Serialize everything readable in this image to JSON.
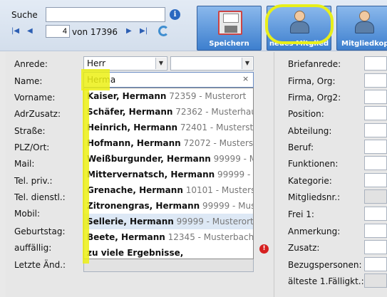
{
  "toolbar": {
    "search_label": "Suche",
    "search_value": "",
    "record_number": "4",
    "record_total": "von 17396",
    "buttons": {
      "save": "Speichern",
      "new_member": "neues Mitglied",
      "member_copy": "Mitgliedkop"
    },
    "icons": [
      "info-icon",
      "first-record-icon",
      "prev-record-icon",
      "next-record-icon",
      "last-record-icon",
      "refresh-icon",
      "floppy-disk-icon",
      "person-icon"
    ]
  },
  "form": {
    "labels": {
      "anrede": "Anrede:",
      "name": "Name:",
      "vorname": "Vorname:",
      "adrzusatz": "AdrZusatz:",
      "strasse": "Straße:",
      "plz_ort": "PLZ/Ort:",
      "mail": "Mail:",
      "tel_priv": "Tel. priv.:",
      "tel_dienst": "Tel. dienstl.:",
      "mobil": "Mobil:",
      "geburtstag": "Geburtstag:",
      "auffaellig": "auffällig:",
      "letzte_aend": "Letzte Änd.:"
    },
    "anrede_value": "Herr",
    "anrede2_value": "",
    "name_value": "Herma",
    "name_clear": "×"
  },
  "suggestions": [
    {
      "name": "Kaiser, Hermann",
      "meta": "72359 - Musterort"
    },
    {
      "name": "Schäfer, Hermann",
      "meta": "72362 - Musterhau"
    },
    {
      "name": "Heinrich, Hermann",
      "meta": "72401 - Musterst"
    },
    {
      "name": "Hofmann, Hermann",
      "meta": "72072 - Musterst"
    },
    {
      "name": "Weißburgunder, Hermann",
      "meta": "99999 - M"
    },
    {
      "name": "Mittervernatsch, Hermann",
      "meta": "99999 - Mu"
    },
    {
      "name": "Grenache, Hermann",
      "meta": "10101 - Musterst"
    },
    {
      "name": "Zitronengras, Hermann",
      "meta": "99999 - Muster"
    },
    {
      "name": "Sellerie, Hermann",
      "meta": "99999 - Musterort"
    },
    {
      "name": "Beete, Hermann",
      "meta": "12345 - Musterbach"
    },
    {
      "name": "zu viele Ergebnisse,",
      "meta": ""
    }
  ],
  "right": {
    "labels": {
      "briefanrede": "Briefanrede:",
      "firma_org": "Firma, Org:",
      "firma_org2": "Firma, Org2:",
      "position": "Position:",
      "abteilung": "Abteilung:",
      "beruf": "Beruf:",
      "funktionen": "Funktionen:",
      "kategorie": "Kategorie:",
      "mitgliedsnr": "Mitgliedsnr.:",
      "frei1": "Frei 1:",
      "anmerkung": "Anmerkung:",
      "zusatz": "Zusatz:",
      "bezugspersonen": "Bezugspersonen:",
      "aelteste": "älteste 1.Fälligkt.:"
    }
  },
  "colors": {
    "toolbar_button": "#5b95dc",
    "highlight": "#e8ef1a",
    "alert": "#d62020"
  }
}
